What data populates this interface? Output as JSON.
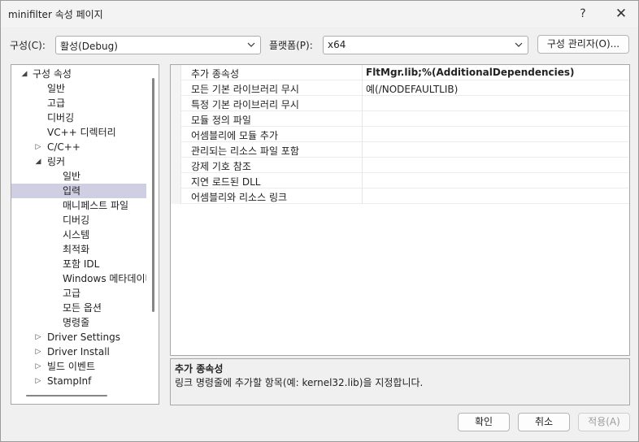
{
  "window": {
    "title": "minifilter 속성 페이지",
    "help_glyph": "?",
    "close_glyph": "✕"
  },
  "toolbar": {
    "config_label": "구성(C):",
    "config_value": "활성(Debug)",
    "platform_label": "플랫폼(P):",
    "platform_value": "x64",
    "config_manager_label": "구성 관리자(O)..."
  },
  "tree": {
    "items": [
      {
        "label": "구성 속성",
        "state": "expanded"
      },
      {
        "label": "일반",
        "state": "none"
      },
      {
        "label": "고급",
        "state": "none"
      },
      {
        "label": "디버깅",
        "state": "none"
      },
      {
        "label": "VC++ 디렉터리",
        "state": "none"
      },
      {
        "label": "C/C++",
        "state": "collapsed"
      },
      {
        "label": "링커",
        "state": "expanded"
      },
      {
        "label": "일반",
        "state": "none"
      },
      {
        "label": "입력",
        "state": "none",
        "selected": true
      },
      {
        "label": "매니페스트 파일",
        "state": "none"
      },
      {
        "label": "디버깅",
        "state": "none"
      },
      {
        "label": "시스템",
        "state": "none"
      },
      {
        "label": "최적화",
        "state": "none"
      },
      {
        "label": "포함 IDL",
        "state": "none"
      },
      {
        "label": "Windows 메타데이터",
        "state": "none"
      },
      {
        "label": "고급",
        "state": "none"
      },
      {
        "label": "모든 옵션",
        "state": "none"
      },
      {
        "label": "명령줄",
        "state": "none"
      },
      {
        "label": "Driver Settings",
        "state": "collapsed"
      },
      {
        "label": "Driver Install",
        "state": "collapsed"
      },
      {
        "label": "빌드 이벤트",
        "state": "collapsed"
      },
      {
        "label": "StampInf",
        "state": "collapsed"
      }
    ]
  },
  "properties": {
    "rows": [
      {
        "name": "추가 종속성",
        "value": "FltMgr.lib;%(AdditionalDependencies)",
        "bold": true
      },
      {
        "name": "모든 기본 라이브러리 무시",
        "value": "예(/NODEFAULTLIB)"
      },
      {
        "name": "특정 기본 라이브러리 무시",
        "value": ""
      },
      {
        "name": "모듈 정의 파일",
        "value": ""
      },
      {
        "name": "어셈블리에 모듈 추가",
        "value": ""
      },
      {
        "name": "관리되는 리소스 파일 포함",
        "value": ""
      },
      {
        "name": "강제 기호 참조",
        "value": ""
      },
      {
        "name": "지연 로드된 DLL",
        "value": ""
      },
      {
        "name": "어셈블리와 리소스 링크",
        "value": ""
      }
    ]
  },
  "description": {
    "title": "추가 종속성",
    "text": "링크 명령줄에 추가할 항목(예: kernel32.lib)을 지정합니다."
  },
  "buttons": {
    "ok": "확인",
    "cancel": "취소",
    "apply": "적용(A)"
  },
  "icons": {
    "expanded": "chevron-down-icon",
    "collapsed": "chevron-right-icon",
    "dropdown": "dropdown-arrow-icon"
  }
}
